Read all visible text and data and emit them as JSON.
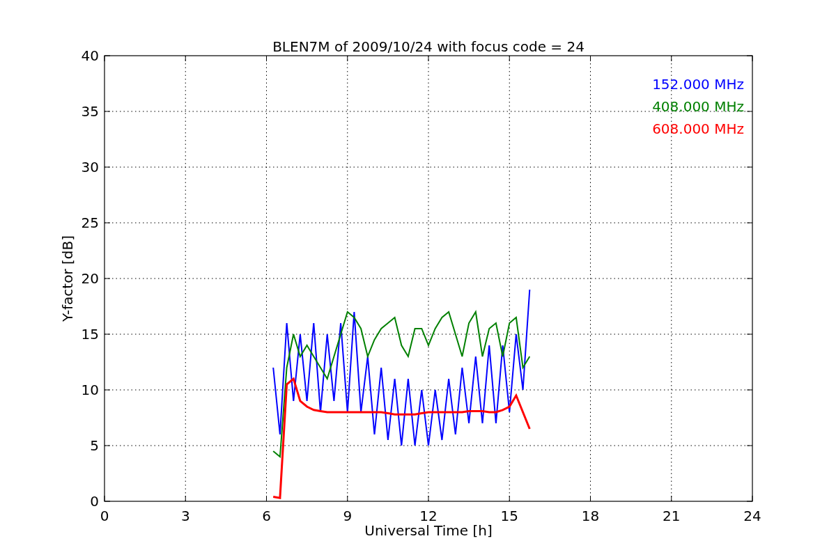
{
  "chart_data": {
    "type": "line",
    "title": "BLEN7M of 2009/10/24 with focus code = 24",
    "xlabel": "Universal Time [h]",
    "ylabel": "Y-factor [dB]",
    "x": [
      6.25,
      6.5,
      6.75,
      7,
      7.25,
      7.5,
      7.75,
      8,
      8.25,
      8.5,
      8.75,
      9,
      9.25,
      9.5,
      9.75,
      10,
      10.25,
      10.5,
      10.75,
      11,
      11.25,
      11.5,
      11.75,
      12,
      12.25,
      12.5,
      12.75,
      13,
      13.25,
      13.5,
      13.75,
      14,
      14.25,
      14.5,
      14.75,
      15,
      15.25,
      15.5,
      15.75
    ],
    "series": [
      {
        "name": "152.000 MHz",
        "color": "#0000ff",
        "values": [
          12,
          6,
          16,
          9,
          15,
          9,
          16,
          8,
          15,
          9,
          16,
          8,
          17,
          8,
          13,
          6,
          12,
          5.5,
          11,
          5,
          11,
          5,
          10,
          5,
          10,
          5.5,
          11,
          6,
          12,
          7,
          13,
          7,
          14,
          7,
          14,
          8,
          15,
          10,
          19
        ]
      },
      {
        "name": "408.000 MHz",
        "color": "#008000",
        "values": [
          4.5,
          4,
          12,
          15,
          13,
          14,
          13,
          12,
          11,
          13,
          15,
          17,
          16.5,
          15.5,
          13,
          14.5,
          15.5,
          16,
          16.5,
          14,
          13,
          15.5,
          15.5,
          14,
          15.5,
          16.5,
          17,
          15,
          13,
          16,
          17,
          13,
          15.5,
          16,
          13,
          16,
          16.5,
          12,
          13
        ]
      },
      {
        "name": "608.000 MHz",
        "color": "#ff0000",
        "values": [
          0.4,
          0.3,
          10.5,
          11,
          9,
          8.5,
          8.2,
          8.1,
          8,
          8,
          8,
          8,
          8,
          8,
          8,
          8,
          8,
          7.9,
          7.8,
          7.8,
          7.8,
          7.8,
          7.9,
          8,
          8,
          8,
          8,
          8,
          8,
          8.1,
          8.1,
          8.1,
          8,
          8,
          8.2,
          8.5,
          9.5,
          8,
          6.5
        ]
      }
    ],
    "grid": true,
    "xlim": [
      0,
      24
    ],
    "ylim": [
      0,
      40
    ],
    "xticks": [
      0,
      3,
      6,
      9,
      12,
      15,
      18,
      21,
      24
    ],
    "yticks": [
      0,
      5,
      10,
      15,
      20,
      25,
      30,
      35,
      40
    ]
  }
}
